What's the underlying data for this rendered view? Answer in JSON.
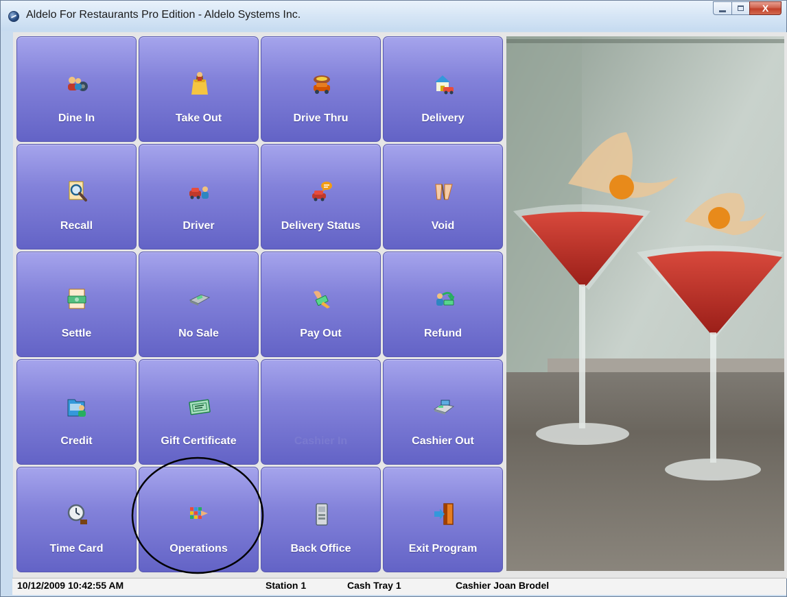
{
  "window": {
    "title": "Aldelo For Restaurants Pro Edition - Aldelo Systems Inc.",
    "controls": {
      "minimize_icon": "minimize-icon",
      "maximize_icon": "maximize-icon",
      "close_label": "X"
    }
  },
  "tiles": [
    {
      "label": "Dine In",
      "icon": "dine-in-icon",
      "enabled": true
    },
    {
      "label": "Take Out",
      "icon": "take-out-bag-icon",
      "enabled": true
    },
    {
      "label": "Drive Thru",
      "icon": "drive-thru-car-icon",
      "enabled": true
    },
    {
      "label": "Delivery",
      "icon": "delivery-house-car-icon",
      "enabled": true
    },
    {
      "label": "Recall",
      "icon": "recall-magnifier-icon",
      "enabled": true
    },
    {
      "label": "Driver",
      "icon": "driver-icon",
      "enabled": true
    },
    {
      "label": "Delivery Status",
      "icon": "delivery-status-icon",
      "enabled": true
    },
    {
      "label": "Void",
      "icon": "void-icon",
      "enabled": true
    },
    {
      "label": "Settle",
      "icon": "settle-cash-icon",
      "enabled": true
    },
    {
      "label": "No Sale",
      "icon": "no-sale-drawer-icon",
      "enabled": true
    },
    {
      "label": "Pay Out",
      "icon": "pay-out-hand-icon",
      "enabled": true
    },
    {
      "label": "Refund",
      "icon": "refund-icon",
      "enabled": true
    },
    {
      "label": "Credit",
      "icon": "credit-folder-icon",
      "enabled": true
    },
    {
      "label": "Gift Certificate",
      "icon": "gift-certificate-icon",
      "enabled": true
    },
    {
      "label": "Cashier In",
      "icon": "",
      "enabled": false
    },
    {
      "label": "Cashier Out",
      "icon": "cashier-out-register-icon",
      "enabled": true
    },
    {
      "label": "Time Card",
      "icon": "time-card-clock-icon",
      "enabled": true
    },
    {
      "label": "Operations",
      "icon": "operations-grid-icon",
      "enabled": true
    },
    {
      "label": "Back Office",
      "icon": "back-office-server-icon",
      "enabled": true
    },
    {
      "label": "Exit Program",
      "icon": "exit-door-icon",
      "enabled": true
    }
  ],
  "colors": {
    "tile_top": "#a5a4ec",
    "tile_bottom": "#6363c6",
    "tile_text": "#ffffff",
    "annotation_circle": "#000000"
  },
  "status": {
    "datetime": "10/12/2009 10:42:55 AM",
    "station": "Station 1",
    "cash_tray": "Cash Tray 1",
    "cashier": "Cashier Joan Brodel"
  }
}
